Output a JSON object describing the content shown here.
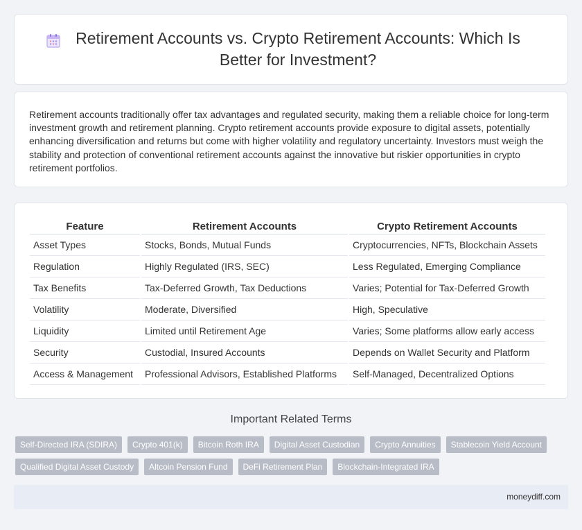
{
  "header": {
    "title": "Retirement Accounts vs. Crypto Retirement Accounts: Which Is Better for Investment?",
    "icon": "calendar-icon"
  },
  "intro": {
    "text": "Retirement accounts traditionally offer tax advantages and regulated security, making them a reliable choice for long-term investment growth and retirement planning. Crypto retirement accounts provide exposure to digital assets, potentially enhancing diversification and returns but come with higher volatility and regulatory uncertainty. Investors must weigh the stability and protection of conventional retirement accounts against the innovative but riskier opportunities in crypto retirement portfolios."
  },
  "table": {
    "headers": [
      "Feature",
      "Retirement Accounts",
      "Crypto Retirement Accounts"
    ],
    "rows": [
      [
        "Asset Types",
        "Stocks, Bonds, Mutual Funds",
        "Cryptocurrencies, NFTs, Blockchain Assets"
      ],
      [
        "Regulation",
        "Highly Regulated (IRS, SEC)",
        "Less Regulated, Emerging Compliance"
      ],
      [
        "Tax Benefits",
        "Tax-Deferred Growth, Tax Deductions",
        "Varies; Potential for Tax-Deferred Growth"
      ],
      [
        "Volatility",
        "Moderate, Diversified",
        "High, Speculative"
      ],
      [
        "Liquidity",
        "Limited until Retirement Age",
        "Varies; Some platforms allow early access"
      ],
      [
        "Security",
        "Custodial, Insured Accounts",
        "Depends on Wallet Security and Platform"
      ],
      [
        "Access & Management",
        "Professional Advisors, Established Platforms",
        "Self-Managed, Decentralized Options"
      ]
    ]
  },
  "terms": {
    "heading": "Important Related Terms",
    "tags": [
      "Self-Directed IRA (SDIRA)",
      "Crypto 401(k)",
      "Bitcoin Roth IRA",
      "Digital Asset Custodian",
      "Crypto Annuities",
      "Stablecoin Yield Account",
      "Qualified Digital Asset Custody",
      "Altcoin Pension Fund",
      "DeFi Retirement Plan",
      "Blockchain-Integrated IRA"
    ]
  },
  "footer": {
    "site": "moneydiff.com"
  }
}
